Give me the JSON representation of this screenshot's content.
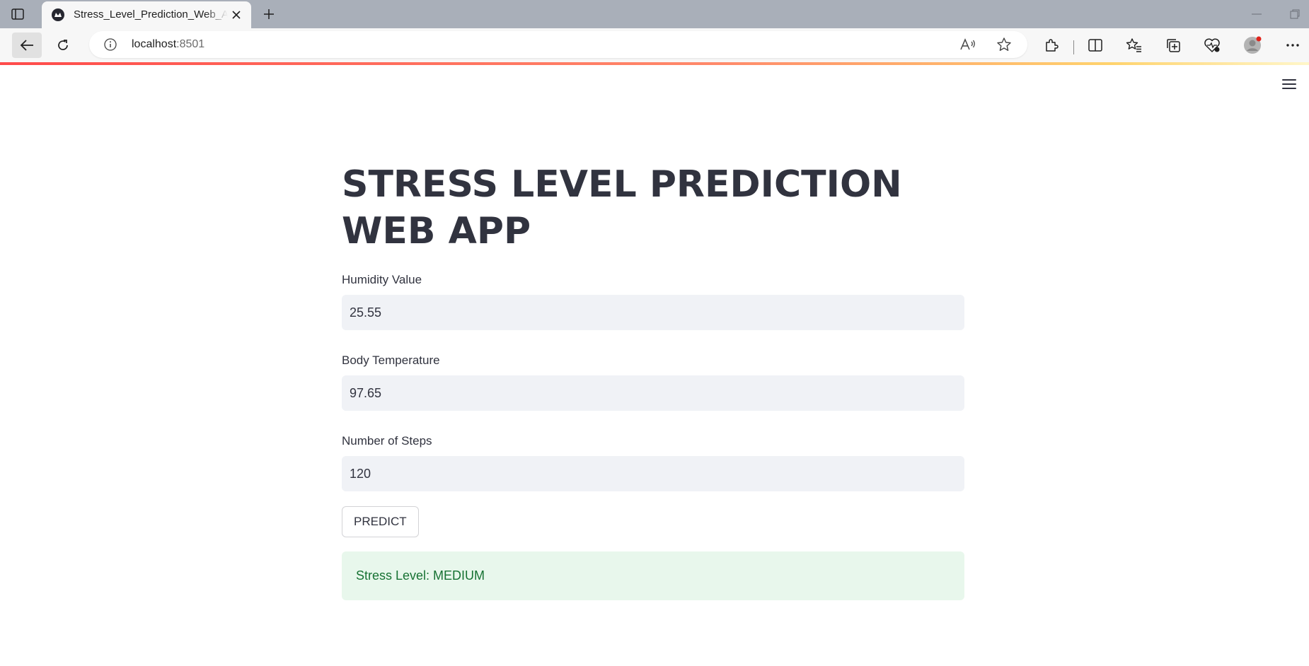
{
  "browser": {
    "tab_title": "Stress_Level_Prediction_Web_App",
    "url_host": "localhost",
    "url_port": ":8501"
  },
  "app": {
    "title": "STRESS LEVEL PREDICTION WEB APP",
    "fields": [
      {
        "label": "Humidity Value",
        "value": "25.55"
      },
      {
        "label": "Body Temperature",
        "value": "97.65"
      },
      {
        "label": "Number of Steps",
        "value": "120"
      }
    ],
    "predict_label": "PREDICT",
    "result": "Stress Level: MEDIUM"
  },
  "colors": {
    "text": "#31333f",
    "input_bg": "#f0f2f6",
    "success_bg": "#e8f7ec",
    "success_text": "#177233",
    "accent": "#ff4b4b"
  }
}
